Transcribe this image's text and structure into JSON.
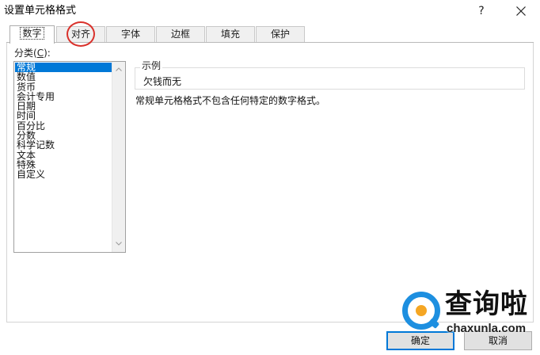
{
  "window": {
    "title": "设置单元格格式",
    "help_label": "?",
    "close_icon": "close-icon"
  },
  "tabs": [
    {
      "label": "数字",
      "active": true
    },
    {
      "label": "对齐",
      "active": false
    },
    {
      "label": "字体",
      "active": false
    },
    {
      "label": "边框",
      "active": false
    },
    {
      "label": "填充",
      "active": false
    },
    {
      "label": "保护",
      "active": false
    }
  ],
  "category": {
    "label_prefix": "分类(",
    "label_key": "C",
    "label_suffix": "):",
    "items": [
      "常规",
      "数值",
      "货币",
      "会计专用",
      "日期",
      "时间",
      "百分比",
      "分数",
      "科学记数",
      "文本",
      "特殊",
      "自定义"
    ],
    "selected": "常规"
  },
  "sample": {
    "label": "示例",
    "value": "欠钱而无"
  },
  "description": "常规单元格格式不包含任何特定的数字格式。",
  "buttons": {
    "ok": "确定",
    "cancel": "取消"
  },
  "watermark": {
    "name": "查询啦",
    "domain": "chaxunla.com"
  },
  "colors": {
    "selection": "#0078d7",
    "highlight_circle": "#d9312b",
    "logo_blue": "#1d8fe0",
    "logo_orange": "#f5a623"
  }
}
